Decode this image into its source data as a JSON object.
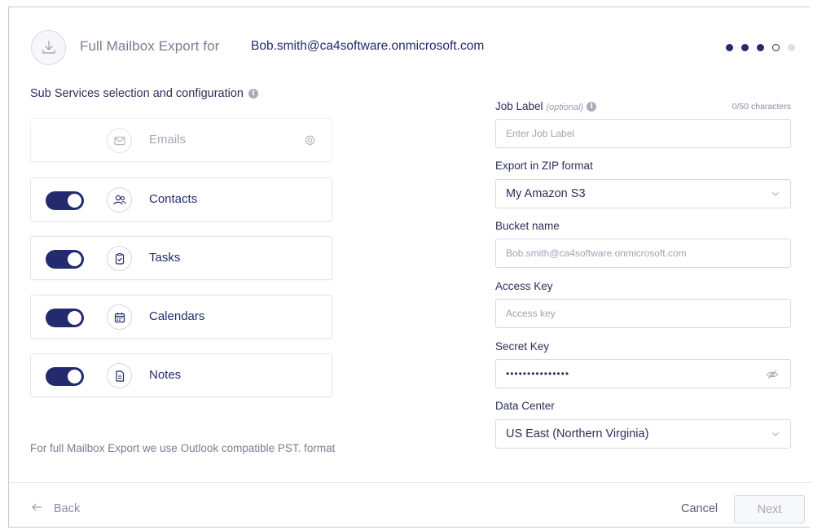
{
  "header": {
    "title": "Full Mailbox Export for",
    "email": "Bob.smith@ca4software.onmicrosoft.com",
    "steps": [
      "done",
      "done",
      "done",
      "current",
      "todo"
    ]
  },
  "left": {
    "section_title": "Sub Services selection and configuration",
    "services": [
      {
        "label": "Emails",
        "enabled": false,
        "icon": "envelope-icon",
        "has_settings": true
      },
      {
        "label": "Contacts",
        "enabled": true,
        "icon": "contacts-icon"
      },
      {
        "label": "Tasks",
        "enabled": true,
        "icon": "tasks-icon"
      },
      {
        "label": "Calendars",
        "enabled": true,
        "icon": "calendar-icon"
      },
      {
        "label": "Notes",
        "enabled": true,
        "icon": "notes-icon"
      }
    ],
    "footnote": "For full Mailbox Export we use Outlook compatible PST. format"
  },
  "form": {
    "job_label": {
      "label": "Job Label",
      "optional": "(optional)",
      "counter": "0/50 characters",
      "placeholder": "Enter Job Label"
    },
    "export_zip": {
      "label": "Export in ZIP format",
      "value": "My Amazon S3"
    },
    "bucket": {
      "label": "Bucket name",
      "placeholder": "Bob.smith@ca4software.onmicrosoft.com"
    },
    "access_key": {
      "label": "Access Key",
      "placeholder": "Access key"
    },
    "secret_key": {
      "label": "Secret Key",
      "value": "•••••••••••••••"
    },
    "data_center": {
      "label": "Data Center",
      "value": "US East (Northern Virginia)"
    }
  },
  "footer": {
    "back": "Back",
    "cancel": "Cancel",
    "next": "Next"
  },
  "colors": {
    "accent": "#232a6e",
    "muted": "#7a7d90",
    "border": "#d7d9e2"
  }
}
